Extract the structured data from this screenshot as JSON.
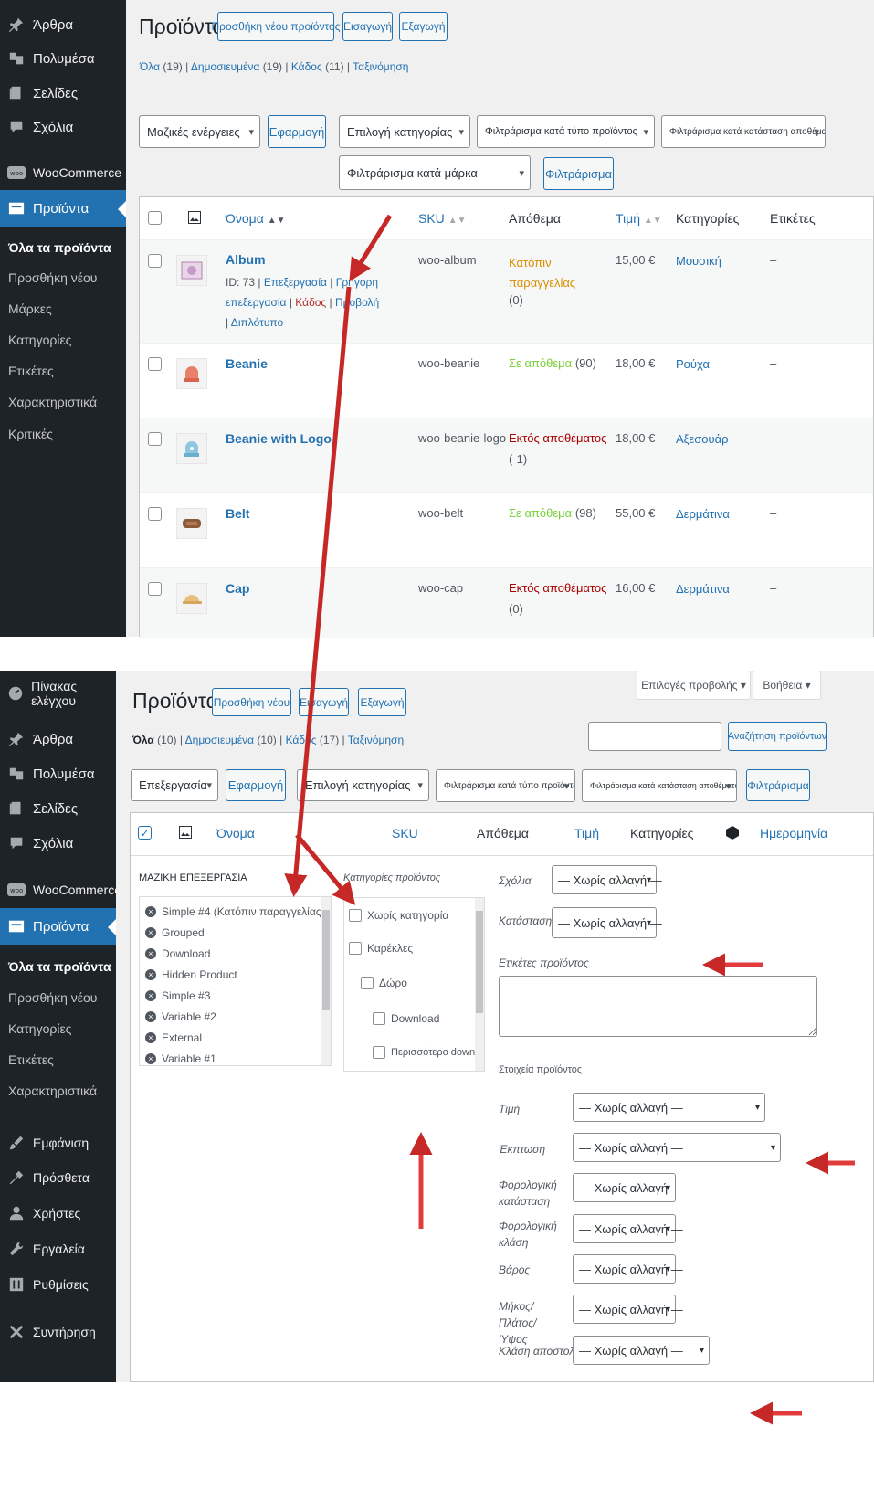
{
  "top": {
    "sidebar": {
      "items": [
        {
          "label": "Άρθρα",
          "icon": "pin-icon"
        },
        {
          "label": "Πολυμέσα",
          "icon": "media-icon"
        },
        {
          "label": "Σελίδες",
          "icon": "pages-icon"
        },
        {
          "label": "Σχόλια",
          "icon": "comments-icon"
        },
        {
          "label": "WooCommerce",
          "icon": "woo-icon"
        },
        {
          "label": "Προϊόντα",
          "icon": "products-icon"
        }
      ],
      "submenu": [
        "Όλα τα προϊόντα",
        "Προσθήκη νέου",
        "Μάρκες",
        "Κατηγορίες",
        "Ετικέτες",
        "Χαρακτηριστικά",
        "Κριτικές"
      ]
    },
    "title": "Προϊόντα",
    "add_new": "Προσθήκη νέου προϊόντος",
    "import": "Εισαγωγή",
    "export": "Εξαγωγή",
    "status": {
      "all": "Όλα",
      "all_count": "(19)",
      "published": "Δημοσιευμένα",
      "published_count": "(19)",
      "trash": "Κάδος",
      "trash_count": "(11)",
      "sorting": "Ταξινόμηση"
    },
    "filters": {
      "bulk": "Μαζικές ενέργειες",
      "apply": "Εφαρμογή",
      "category": "Επιλογή κατηγορίας",
      "type": "Φιλτράρισμα κατά τύπο προϊόντος",
      "stock": "Φιλτράρισμα κατά κατάσταση αποθέματος",
      "brand": "Φιλτράρισμα κατά μάρκα",
      "filter": "Φιλτράρισμα"
    },
    "columns": {
      "name": "Όνομα",
      "sku": "SKU",
      "stock": "Απόθεμα",
      "price": "Τιμή",
      "categories": "Κατηγορίες",
      "tags": "Ετικέτες"
    },
    "rows": [
      {
        "name": "Album",
        "sku": "woo-album",
        "stock": "Κατόπιν παραγγελίας",
        "stock2": "",
        "stock_count": "(0)",
        "price": "15,00 €",
        "category": "Μουσική",
        "tags": "–",
        "row_actions": {
          "id": "ID: 73",
          "edit": "Επεξεργασία",
          "quick": "Γρήγορη επεξεργασία",
          "trash": "Κάδος",
          "view": "Προβολή",
          "dup": "Διπλότυπο"
        }
      },
      {
        "name": "Beanie",
        "sku": "woo-beanie",
        "stock": "Σε απόθεμα",
        "stock_count": "(90)",
        "price": "18,00 €",
        "category": "Ρούχα",
        "tags": "–"
      },
      {
        "name": "Beanie with Logo",
        "sku": "woo-beanie-logo",
        "stock": "Εκτός αποθέματος",
        "stock_count": "(-1)",
        "price": "18,00 €",
        "category": "Αξεσουάρ",
        "tags": "–"
      },
      {
        "name": "Belt",
        "sku": "woo-belt",
        "stock": "Σε απόθεμα",
        "stock_count": "(98)",
        "price": "55,00 €",
        "category": "Δερμάτινα",
        "tags": "–"
      },
      {
        "name": "Cap",
        "sku": "woo-cap",
        "stock": "Εκτός αποθέματος",
        "stock_count": "(0)",
        "price": "16,00 €",
        "category": "Δερμάτινα",
        "tags": "–"
      }
    ]
  },
  "bottom": {
    "sidebar": {
      "items": [
        {
          "label": "Πίνακας ελέγχου",
          "icon": "dashboard-icon"
        },
        {
          "label": "Άρθρα",
          "icon": "pin-icon"
        },
        {
          "label": "Πολυμέσα",
          "icon": "media-icon"
        },
        {
          "label": "Σελίδες",
          "icon": "pages-icon"
        },
        {
          "label": "Σχόλια",
          "icon": "comments-icon"
        },
        {
          "label": "WooCommerce",
          "icon": "woo-icon"
        },
        {
          "label": "Προϊόντα",
          "icon": "products-icon"
        }
      ],
      "submenu": [
        "Όλα τα προϊόντα",
        "Προσθήκη νέου",
        "Κατηγορίες",
        "Ετικέτες",
        "Χαρακτηριστικά"
      ],
      "items2": [
        {
          "label": "Εμφάνιση",
          "icon": "brush-icon"
        },
        {
          "label": "Πρόσθετα",
          "icon": "plugin-icon"
        },
        {
          "label": "Χρήστες",
          "icon": "user-icon"
        },
        {
          "label": "Εργαλεία",
          "icon": "wrench-icon"
        },
        {
          "label": "Ρυθμίσεις",
          "icon": "settings-icon"
        },
        {
          "label": "Συντήρηση",
          "icon": "tools-icon"
        }
      ]
    },
    "title": "Προϊόντα",
    "add_new": "Προσθήκη νέου",
    "import": "Εισαγωγή",
    "export": "Εξαγωγή",
    "screen_options": "Επιλογές προβολής",
    "help": "Βοήθεια",
    "status": {
      "all": "Όλα",
      "all_count": "(10)",
      "published": "Δημοσιευμένα",
      "published_count": "(10)",
      "trash": "Κάδος",
      "trash_count": "(17)",
      "sorting": "Ταξινόμηση"
    },
    "search_button": "Αναζήτηση προϊόντων",
    "search_value": "",
    "filters": {
      "bulk": "Επεξεργασία",
      "apply": "Εφαρμογή",
      "category": "Επιλογή κατηγορίας",
      "type": "Φιλτράρισμα κατά τύπο προϊόντος",
      "stock": "Φιλτράρισμα κατά κατάσταση αποθέματος",
      "filter": "Φιλτράρισμα"
    },
    "columns": {
      "name": "Όνομα",
      "sku": "SKU",
      "stock": "Απόθεμα",
      "price": "Τιμή",
      "categories": "Κατηγορίες",
      "date": "Ημερομηνία"
    },
    "bulk_edit": {
      "heading": "ΜΑΖΙΚΗ ΕΠΕΞΕΡΓΑΣΙΑ",
      "products": [
        "Simple #4 (Κατόπιν παραγγελίας)",
        "Grouped",
        "Download",
        "Hidden Product",
        "Simple #3",
        "Variable #2",
        "External",
        "Variable #1"
      ],
      "cat_heading": "Κατηγορίες προϊόντος",
      "cats": [
        "Χωρίς κατηγορία",
        "Καρέκλες",
        "Δώρο",
        "Download",
        "Περισσότερο download"
      ],
      "comments_label": "Σχόλια",
      "status_label": "Κατάσταση",
      "tags_label": "Ετικέτες προϊόντος",
      "data_heading": "Στοιχεία προϊόντος",
      "price_label": "Τιμή",
      "sale_label": "Έκπτωση",
      "tax_status_label": "Φορολογική κατάσταση",
      "tax_class_label": "Φορολογική κλάση",
      "weight_label": "Βάρος",
      "dims_label": "Μήκος/Πλάτος/Ύψος",
      "shipping_label": "Κλάση αποστολής",
      "no_change": "— Χωρίς αλλαγή —"
    }
  },
  "colors": {
    "sidebar": "#1d2327",
    "accent": "#2271b1",
    "arrow": "#c62828"
  }
}
